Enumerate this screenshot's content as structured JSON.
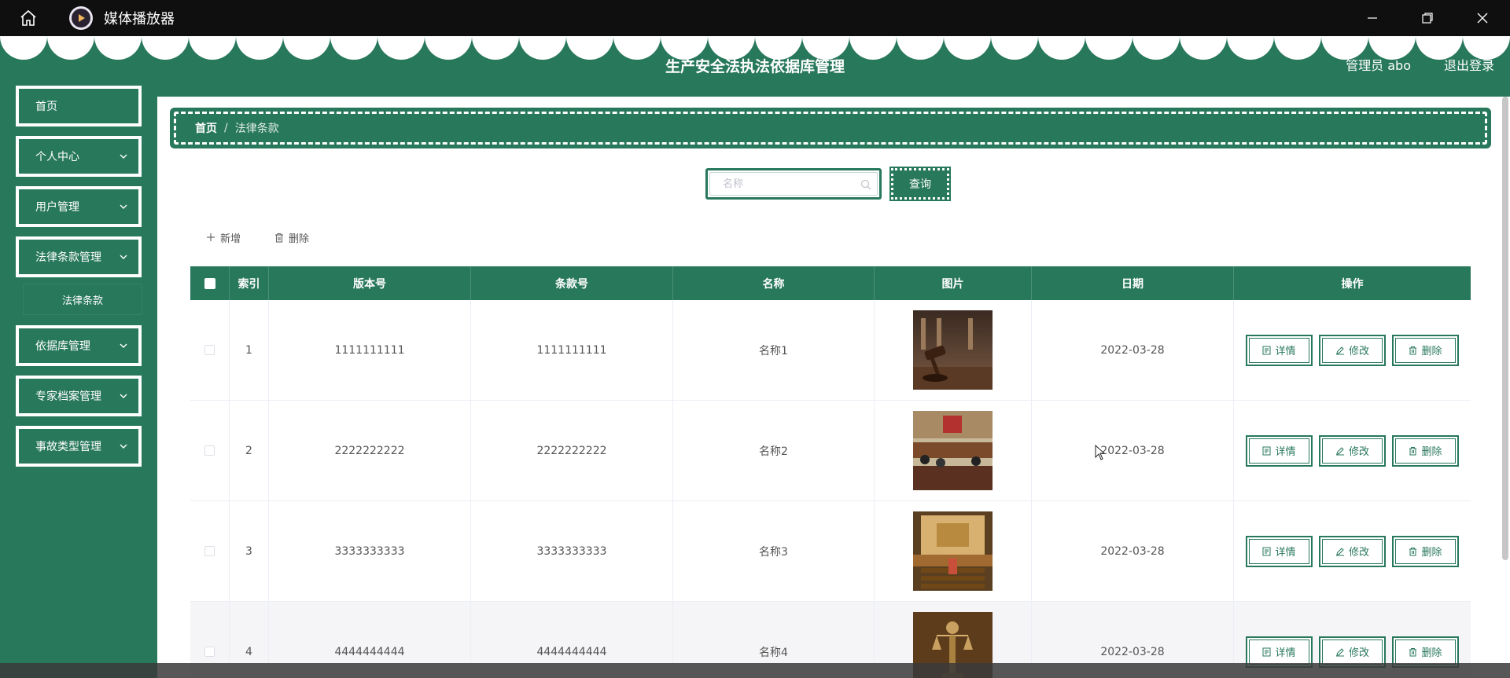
{
  "window": {
    "title": "媒体播放器"
  },
  "header": {
    "title": "生产安全法执法依据库管理",
    "user": "管理员 abo",
    "logout": "退出登录"
  },
  "sidebar": {
    "items": [
      {
        "label": "首页"
      },
      {
        "label": "个人中心"
      },
      {
        "label": "用户管理"
      },
      {
        "label": "法律条款管理"
      },
      {
        "label": "依据库管理"
      },
      {
        "label": "专家档案管理"
      },
      {
        "label": "事故类型管理"
      }
    ],
    "sub_item": "法律条款"
  },
  "breadcrumb": {
    "home": "首页",
    "separator": "/",
    "current": "法律条款"
  },
  "search": {
    "placeholder": "名称",
    "value": "",
    "button": "查询"
  },
  "actions": {
    "add": "新增",
    "delete": "删除"
  },
  "table": {
    "columns": [
      "索引",
      "版本号",
      "条款号",
      "名称",
      "图片",
      "日期",
      "操作"
    ],
    "rows": [
      {
        "index": "1",
        "version": "1111111111",
        "article": "1111111111",
        "name": "名称1",
        "date": "2022-03-28"
      },
      {
        "index": "2",
        "version": "2222222222",
        "article": "2222222222",
        "name": "名称2",
        "date": "2022-03-28"
      },
      {
        "index": "3",
        "version": "3333333333",
        "article": "3333333333",
        "name": "名称3",
        "date": "2022-03-28"
      },
      {
        "index": "4",
        "version": "4444444444",
        "article": "4444444444",
        "name": "名称4",
        "date": "2022-03-28"
      }
    ],
    "op_labels": {
      "detail": "详情",
      "edit": "修改",
      "delete": "删除"
    }
  },
  "colors": {
    "primary": "#28785c",
    "titlebar": "#0f0f0f",
    "white": "#ffffff"
  }
}
